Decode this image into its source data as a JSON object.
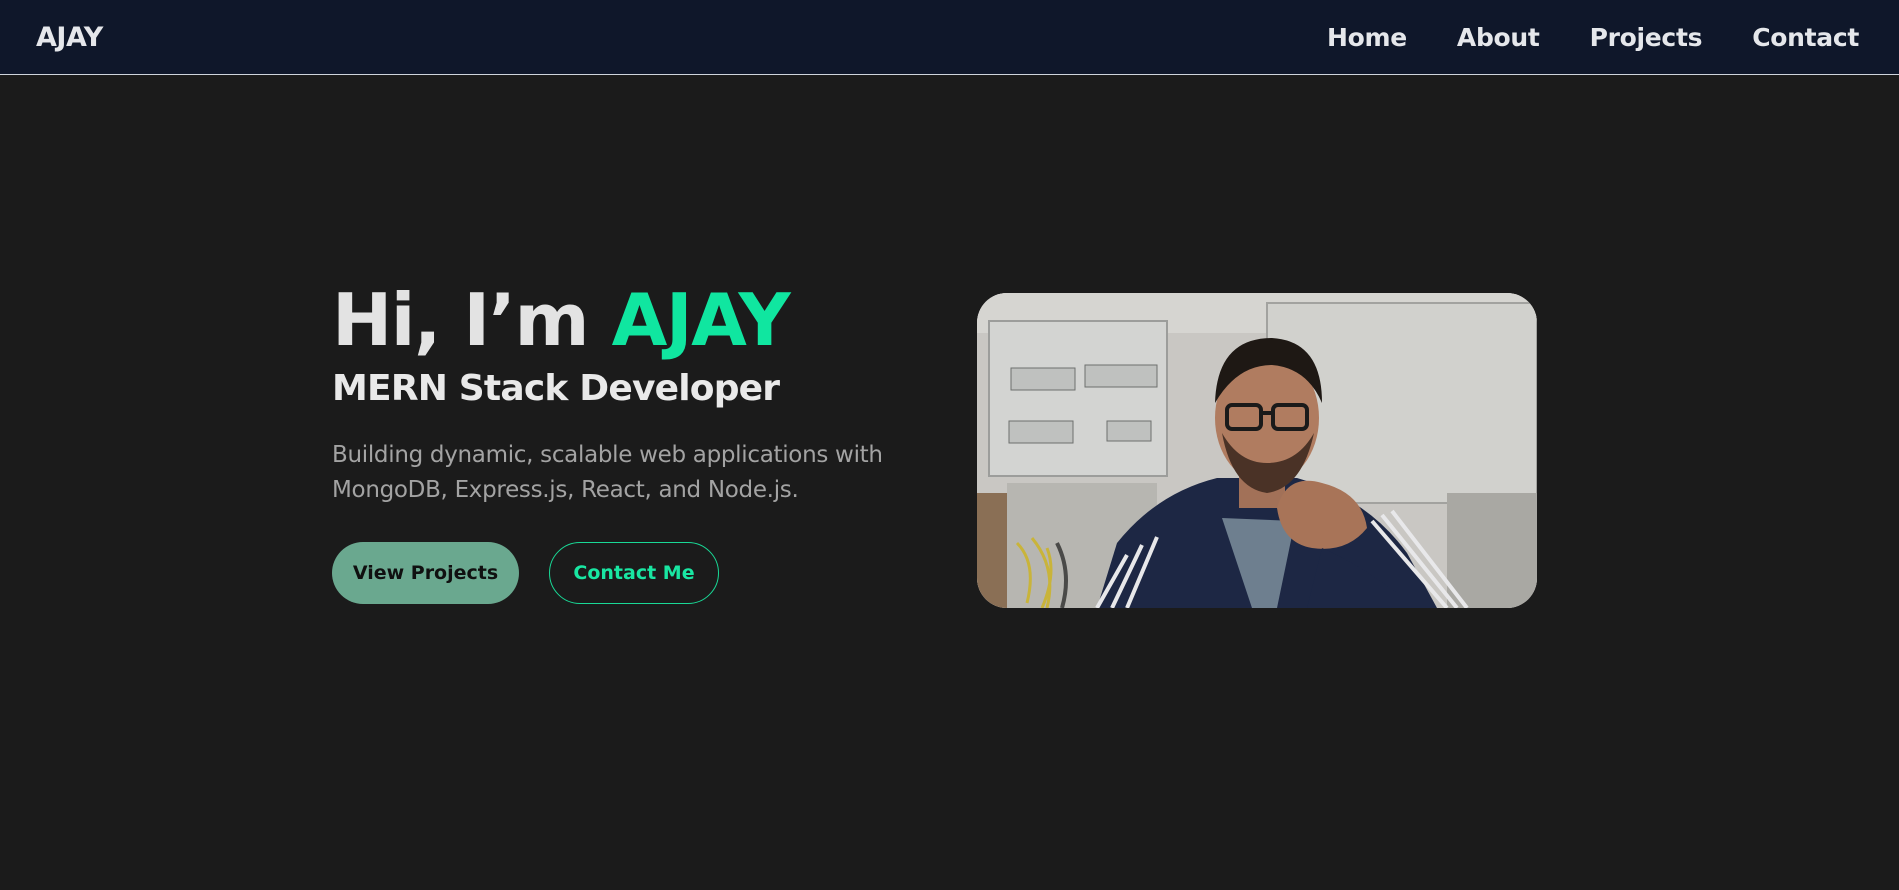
{
  "navbar": {
    "logo": "AJAY",
    "links": [
      {
        "label": "Home"
      },
      {
        "label": "About"
      },
      {
        "label": "Projects"
      },
      {
        "label": "Contact"
      }
    ]
  },
  "hero": {
    "greeting": "Hi, I’m ",
    "name": "AJAY",
    "role": "MERN Stack Developer",
    "description": "Building dynamic, scalable web applications with MongoDB, Express.js, React, and Node.js.",
    "buttons": {
      "primary": "View Projects",
      "secondary": "Contact Me"
    },
    "accent_color": "#10e6a0"
  },
  "colors": {
    "background": "#1b1b1b",
    "navbar": "#0f172a",
    "primary_button": "#6aa88f"
  }
}
